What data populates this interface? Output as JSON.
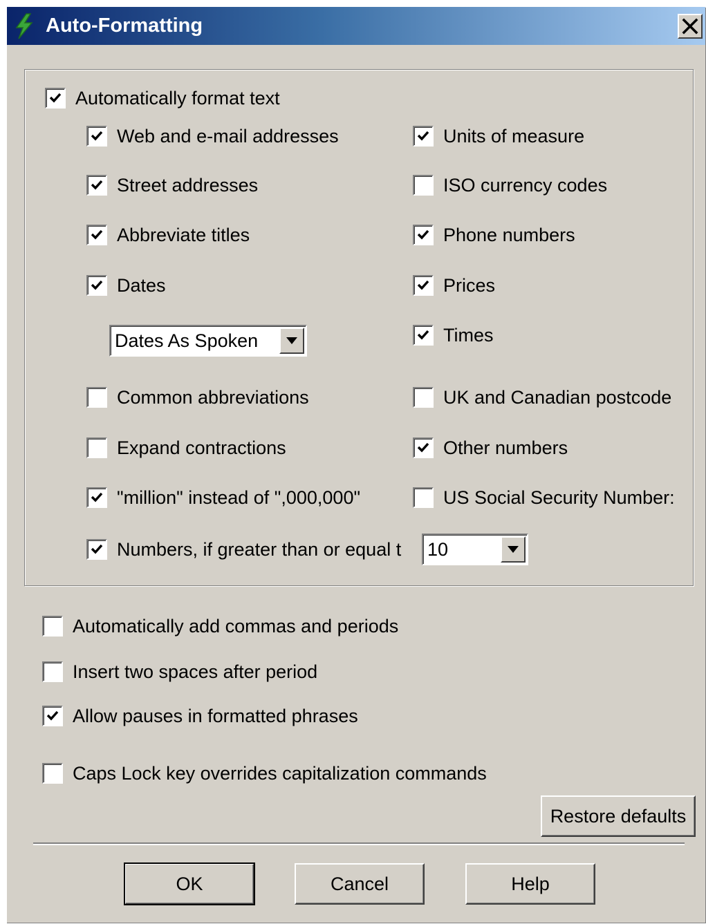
{
  "window": {
    "title": "Auto-Formatting",
    "close_label": "close"
  },
  "group": {
    "master": {
      "label": "Automatically format text",
      "checked": true
    },
    "left": [
      {
        "label": "Web and e-mail addresses",
        "checked": true
      },
      {
        "label": "Street addresses",
        "checked": true
      },
      {
        "label": "Abbreviate titles",
        "checked": true
      },
      {
        "label": "Dates",
        "checked": true
      },
      {
        "label": "Common abbreviations",
        "checked": false
      },
      {
        "label": "Expand contractions",
        "checked": false
      },
      {
        "label": "\"million\" instead of \",000,000\"",
        "checked": true
      },
      {
        "label": "Numbers, if greater than or equal t",
        "checked": true
      }
    ],
    "right": [
      {
        "label": "Units of measure",
        "checked": true
      },
      {
        "label": "ISO currency codes",
        "checked": false
      },
      {
        "label": "Phone numbers",
        "checked": true
      },
      {
        "label": "Prices",
        "checked": true
      },
      {
        "label": "Times",
        "checked": true
      },
      {
        "label": "UK and Canadian postcode",
        "checked": false
      },
      {
        "label": "Other numbers",
        "checked": true
      },
      {
        "label": "US Social Security Number:",
        "checked": false
      }
    ],
    "dates_format": {
      "selected": "Dates As Spoken"
    },
    "number_threshold": {
      "selected": "10"
    }
  },
  "options": [
    {
      "label": "Automatically add commas and periods",
      "checked": false
    },
    {
      "label": "Insert two spaces after period",
      "checked": false
    },
    {
      "label": "Allow pauses in formatted phrases",
      "checked": true
    },
    {
      "label": "Caps Lock key overrides capitalization commands",
      "checked": false
    }
  ],
  "buttons": {
    "restore_defaults": "Restore defaults",
    "ok": "OK",
    "cancel": "Cancel",
    "help": "Help"
  },
  "colors": {
    "dialog_face": "#d4d0c8",
    "title_start": "#0a246a",
    "title_end": "#a6caf0",
    "icon_green": "#3aa63a"
  }
}
